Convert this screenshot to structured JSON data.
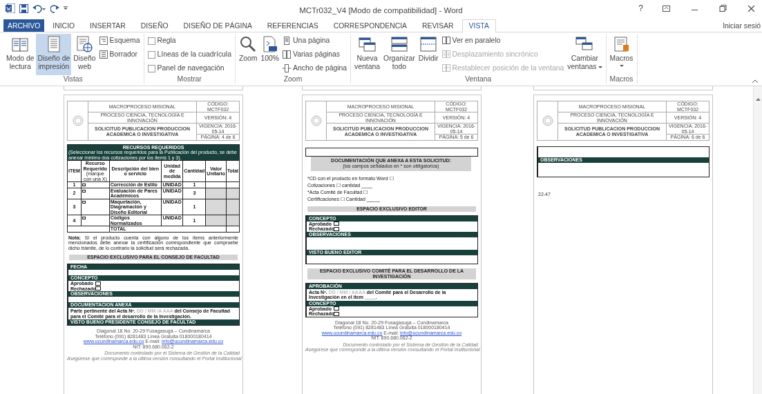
{
  "window": {
    "title": "MCTr032_V4 [Modo de compatibilidad] - Word",
    "help": "?",
    "account": "Iniciar sesió"
  },
  "tabs": [
    {
      "label": "ARCHIVO",
      "kind": "file",
      "selected": false
    },
    {
      "label": "INICIO",
      "kind": "tab",
      "selected": false
    },
    {
      "label": "INSERTAR",
      "kind": "tab",
      "selected": false
    },
    {
      "label": "DISEÑO",
      "kind": "tab",
      "selected": false
    },
    {
      "label": "DISEÑO DE PÁGINA",
      "kind": "tab",
      "selected": false
    },
    {
      "label": "REFERENCIAS",
      "kind": "tab",
      "selected": false
    },
    {
      "label": "CORRESPONDENCIA",
      "kind": "tab",
      "selected": false
    },
    {
      "label": "REVISAR",
      "kind": "tab",
      "selected": false
    },
    {
      "label": "VISTA",
      "kind": "tab",
      "selected": true
    }
  ],
  "ribbon": [
    {
      "label": "Vistas",
      "items": [
        {
          "kind": "large",
          "label": "Modo de\nlectura",
          "selected": false
        },
        {
          "kind": "large",
          "label": "Diseño de\nimpresión",
          "selected": true
        },
        {
          "kind": "large",
          "label": "Diseño\nweb",
          "selected": false
        },
        {
          "kind": "small",
          "label": "Esquema",
          "disabled": false
        },
        {
          "kind": "small",
          "label": "Borrador",
          "disabled": false
        }
      ]
    },
    {
      "label": "Mostrar",
      "items": [
        {
          "kind": "check",
          "label": "Regla",
          "checked": false
        },
        {
          "kind": "check",
          "label": "Líneas de la cuadrícula",
          "checked": false
        },
        {
          "kind": "check",
          "label": "Panel de navegación",
          "checked": false
        }
      ]
    },
    {
      "label": "Zoom",
      "items": [
        {
          "kind": "large",
          "label": "Zoom"
        },
        {
          "kind": "large",
          "label": "100%"
        },
        {
          "kind": "small",
          "label": "Una página",
          "disabled": false
        },
        {
          "kind": "small",
          "label": "Varias páginas",
          "disabled": false
        },
        {
          "kind": "small",
          "label": "Ancho de página",
          "disabled": false
        }
      ]
    },
    {
      "label": "Ventana",
      "items": [
        {
          "kind": "large",
          "label": "Nueva\nventana"
        },
        {
          "kind": "large",
          "label": "Organizar\ntodo"
        },
        {
          "kind": "large",
          "label": "Dividir"
        },
        {
          "kind": "small",
          "label": "Ver en paralelo",
          "disabled": false
        },
        {
          "kind": "small",
          "label": "Desplazamiento sincrónico",
          "disabled": true
        },
        {
          "kind": "small",
          "label": "Restablecer posición de la ventana",
          "disabled": true
        },
        {
          "kind": "large",
          "label": "Cambiar\nventanas",
          "dropdown": true
        }
      ]
    },
    {
      "label": "Macros",
      "items": [
        {
          "kind": "large",
          "label": "Macros",
          "dropdown": true
        }
      ]
    }
  ],
  "pages": [
    {
      "header": {
        "title": "MACROPROCESO MISIONAL",
        "process": "PROCESO CIENCIA, TECNOLOGÍA E INNOVACIÓN",
        "form": "SOLICITUD PUBLICACION PRODUCCION ACADEMICA O INVESTIGATIVA",
        "code": "CÓDIGO: MCTF032",
        "version": "VERSIÓN: 4",
        "validity": "VIGENCIA: 2016-05-14",
        "page": "PÁGINA: 4 de 6"
      },
      "blocks": [
        {
          "kind": "table",
          "title": "RECURSOS REQUERIDOS",
          "subtitle": "(Seleccionar los recursos requeridos para la Publicación del producto, se debe anexar mínimo dos cotizaciones por los ítems 1 y 3).",
          "columns": [
            {
              "label": "ITEM"
            },
            {
              "label": "Recurso Requerido",
              "note": "(marque con una X)"
            },
            {
              "label": "Descripción del bien o servicio"
            },
            {
              "label": "Unidad de medida"
            },
            {
              "label": "Cantidad"
            },
            {
              "label": "Valor Unitario"
            },
            {
              "label": "Total"
            }
          ],
          "rows": [
            {
              "item": "1",
              "checked": false,
              "description": "Corrección de Estilo",
              "unit": "UNIDAD",
              "quantity": "1",
              "shaded": false
            },
            {
              "item": "2",
              "checked": false,
              "description": "Evaluación de Pares Académicos",
              "unit": "UNIDAD",
              "quantity": "3",
              "shaded": true
            },
            {
              "item": "3",
              "checked": false,
              "description": "Maquetación, Diagramación y Diseño Editorial",
              "unit": "UNIDAD",
              "quantity": "1",
              "shaded": true
            },
            {
              "item": "4",
              "checked": false,
              "description": "Códigos Normalizados",
              "unit": "UNIDAD",
              "quantity": "1",
              "shaded": true
            }
          ],
          "total_label": "TOTAL"
        },
        {
          "kind": "note",
          "text": "**Nota:** Si el producto cuenta con alguno de los ítems anteriormente mencionados debe anexar la certificación correspondiente que compruebe dicho trámite, de lo contrario la solicitud será rechazada."
        },
        {
          "kind": "banner",
          "lines": [
            "ESPACIO EXCLUSIVO PARA EL CONSEJO DE FACULTAD"
          ]
        },
        {
          "kind": "form",
          "sections": [
            {
              "title": "FECHA",
              "kind": "blank"
            },
            {
              "title": "CONCEPTO",
              "kind": "checks",
              "options": [
                {
                  "label": "Aprobado",
                  "checked": false
                },
                {
                  "label": "Rechazado",
                  "checked": false
                }
              ]
            },
            {
              "title": "OBSERVACIONES",
              "kind": "blank"
            },
            {
              "title": "DOCUMENTACION ANEXA",
              "kind": "text",
              "parts": [
                {
                  "kind": "bold",
                  "text": "Parte pertinente del Acta Nº. "
                },
                {
                  "kind": "hint",
                  "text": "DD / MM /A AAA"
                },
                {
                  "kind": "bold",
                  "text": " del Consejo de Facultad para el Comité para el desarrollo de la Investigación."
                }
              ]
            },
            {
              "title": "VISTO BUENO PRESIDENTE  CONSEJO DE FACULTAD",
              "kind": "none"
            }
          ]
        }
      ],
      "footer": {
        "lines": [
          "Diagonal 18 No. 20-29 Fusagasugá – Cundinamarca",
          "Teléfono (091) 8281483  Línea Gratuita 018000180414"
        ],
        "web": "www.ucundinamarca.edu.co",
        "email_label": "E-mail:",
        "email": "info@ucundinamarca.edu.co",
        "nit": "NIT: 890.680.062-2",
        "notes": [
          "Documento controlado por el Sistema de Gestión de la Calidad",
          "Asegúrese que corresponde a la última versión consultando el Portal Institucional"
        ]
      }
    },
    {
      "header": {
        "title": "MACROPROCESO MISIONAL",
        "process": "PROCESO CIENCIA, TECNOLOGÍA E INNOVACIÓN",
        "form": "SOLICITUD PUBLICACION PRODUCCION ACADEMICA O INVESTIGATIVA",
        "code": "CÓDIGO: MCTF032",
        "version": "VERSIÓN: 4",
        "validity": "VIGENCIA: 2016-05-14",
        "page": "PÁGINA: 5 de 6"
      },
      "blocks": [
        {
          "kind": "frame"
        },
        {
          "kind": "banner",
          "lines": [
            "DOCUMENTACIÓN QUE ANEXA A ESTA SOLICITUD:",
            "(los campos señalados en * son obligatorios)"
          ]
        },
        {
          "kind": "lines",
          "lines": [
            "*CD con el producto en formato Word ☐",
            "Cotizaciones ☐ cantidad ____",
            "*Acta Comité de Facultad ☐",
            "Certificaciones ☐ Cantidad _____"
          ]
        },
        {
          "kind": "banner",
          "lines": [
            "ESPACIO EXCLUSIVO EDITOR"
          ]
        },
        {
          "kind": "form",
          "sections": [
            {
              "title": "CONCEPTO",
              "kind": "checks",
              "options": [
                {
                  "label": "Aprobado",
                  "checked": false
                },
                {
                  "label": "Rechazado",
                  "checked": false
                }
              ]
            },
            {
              "title": "OBSERVACIONES",
              "kind": "blank"
            },
            {
              "title": "VISTO BUENO EDITOR",
              "kind": "blank"
            }
          ]
        },
        {
          "kind": "banner",
          "lines": [
            "ESPACIO EXCLUSIVO COMITÉ PARA EL DESARROLLO DE LA INVESTIGACIÓN"
          ]
        },
        {
          "kind": "form",
          "sections": [
            {
              "title": "APROBACIÓN",
              "kind": "text",
              "parts": [
                {
                  "kind": "bold",
                  "text": "Acta Nº. "
                },
                {
                  "kind": "hint",
                  "text": "DD / MM / AAAA"
                },
                {
                  "kind": "bold",
                  "text": "  del Comité para el Desarrollo de la Investigación en el ítem ____."
                }
              ]
            },
            {
              "title": "CONCEPTO",
              "kind": "checks",
              "options": [
                {
                  "label": "Aprobado",
                  "checked": false
                },
                {
                  "label": "Rechazado",
                  "checked": false
                }
              ]
            }
          ]
        }
      ],
      "footer": {
        "lines": [
          "Diagonal 18 No. 20-29 Fusagasugá – Cundinamarca",
          "Teléfono (091) 8281483  Línea Gratuita 018000180414"
        ],
        "web": "www.ucundinamarca.edu.co",
        "email_label": "E-mail:",
        "email": "info@ucundinamarca.edu.co",
        "nit": "NIT: 890.680.062-2",
        "notes": [
          "Documento controlado por el Sistema de Gestión de la Calidad",
          "Asegúrese que corresponde a la última versión consultando el Portal Institucional"
        ]
      }
    },
    {
      "header": {
        "title": "MACROPROCESO MISIONAL",
        "process": "PROCESO CIENCIA, TECNOLOGÍA E INNOVACIÓN",
        "form": "SOLICITUD PUBLICACION PRODUCCION ACADEMICA O INVESTIGATIVA",
        "code": "CÓDIGO: MCTF032",
        "version": "VERSIÓN: 4",
        "validity": "VIGENCIA: 2016-05-14",
        "page": "PÁGINA: 6 de 6"
      },
      "blocks": [
        {
          "kind": "form",
          "sections": [
            {
              "kind": "blank"
            },
            {
              "title": "OBSERVACIONES",
              "kind": "blank"
            }
          ]
        },
        {
          "kind": "text",
          "text": "22-47"
        }
      ]
    }
  ]
}
